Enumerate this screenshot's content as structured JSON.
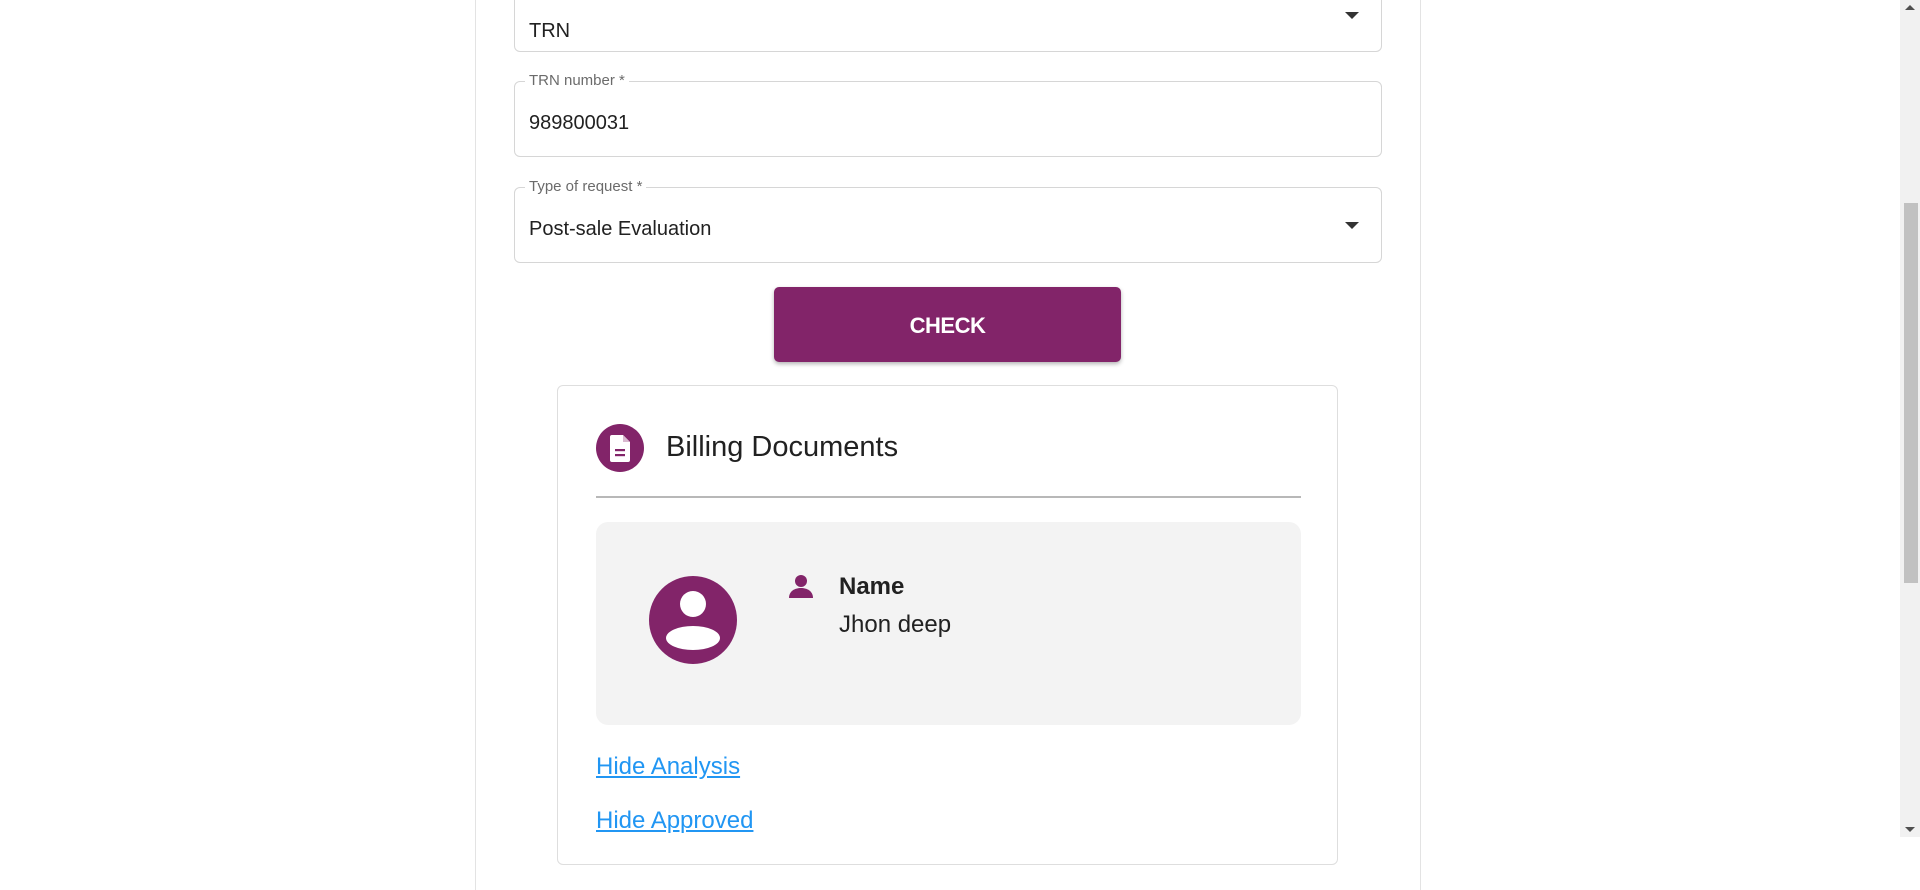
{
  "form": {
    "id_type": {
      "value": "TRN",
      "icon": "chevron-down-icon"
    },
    "trn_number": {
      "label": "TRN number *",
      "value": "989800031"
    },
    "request_type": {
      "label": "Type of request *",
      "value": "Post-sale Evaluation",
      "icon": "chevron-down-icon"
    },
    "check_button": {
      "label": "CHECK"
    }
  },
  "billing_card": {
    "title": "Billing Documents",
    "icon": "document-icon",
    "person": {
      "avatar_icon": "account-circle-icon",
      "field_icon": "person-icon",
      "name_label": "Name",
      "name_value": "Jhon deep"
    },
    "links": [
      {
        "label": "Hide Analysis"
      },
      {
        "label": "Hide Approved"
      }
    ]
  },
  "theme": {
    "accent": "#822469",
    "link": "#2196f3",
    "panel": "#f3f3f3"
  }
}
